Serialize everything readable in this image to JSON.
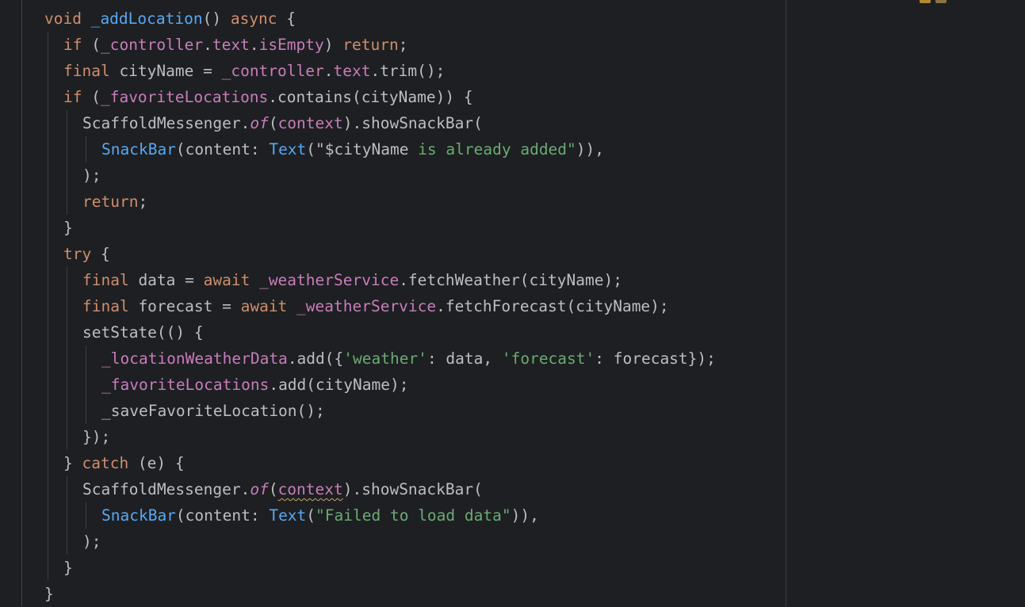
{
  "editor": {
    "language": "Dart",
    "colors": {
      "background": "#1e1f22",
      "default": "#bcbec4",
      "keyword": "#cf8e6d",
      "field": "#c77dbb",
      "method": "#56a8f5",
      "class": "#56a8f5",
      "string": "#6aab73",
      "static_method": "#c77dbb",
      "indent_guide": "#3c3e44",
      "right_margin": "#393b40",
      "warning": "#c9a26d"
    },
    "lines": [
      {
        "indent": 0,
        "tokens": [
          {
            "t": "void ",
            "c": "keyword"
          },
          {
            "t": "_addLocation",
            "c": "method"
          },
          {
            "t": "() ",
            "c": "default"
          },
          {
            "t": "async",
            "c": "keyword"
          },
          {
            "t": " {",
            "c": "default"
          }
        ]
      },
      {
        "indent": 1,
        "tokens": [
          {
            "t": "if",
            "c": "keyword"
          },
          {
            "t": " (",
            "c": "default"
          },
          {
            "t": "_controller",
            "c": "field"
          },
          {
            "t": ".",
            "c": "default"
          },
          {
            "t": "text",
            "c": "field"
          },
          {
            "t": ".",
            "c": "default"
          },
          {
            "t": "isEmpty",
            "c": "field"
          },
          {
            "t": ") ",
            "c": "default"
          },
          {
            "t": "return",
            "c": "keyword"
          },
          {
            "t": ";",
            "c": "default"
          }
        ]
      },
      {
        "indent": 1,
        "tokens": [
          {
            "t": "final",
            "c": "keyword"
          },
          {
            "t": " cityName = ",
            "c": "default"
          },
          {
            "t": "_controller",
            "c": "field"
          },
          {
            "t": ".",
            "c": "default"
          },
          {
            "t": "text",
            "c": "field"
          },
          {
            "t": ".trim();",
            "c": "default"
          }
        ]
      },
      {
        "indent": 1,
        "tokens": [
          {
            "t": "if",
            "c": "keyword"
          },
          {
            "t": " (",
            "c": "default"
          },
          {
            "t": "_favoriteLocations",
            "c": "field"
          },
          {
            "t": ".contains(cityName)) {",
            "c": "default"
          }
        ]
      },
      {
        "indent": 2,
        "tokens": [
          {
            "t": "ScaffoldMessenger.",
            "c": "default"
          },
          {
            "t": "of",
            "c": "static_method",
            "italic": true
          },
          {
            "t": "(",
            "c": "default"
          },
          {
            "t": "context",
            "c": "field"
          },
          {
            "t": ").showSnackBar(",
            "c": "default"
          }
        ]
      },
      {
        "indent": 3,
        "tokens": [
          {
            "t": "SnackBar",
            "c": "class"
          },
          {
            "t": "(content: ",
            "c": "default"
          },
          {
            "t": "Text",
            "c": "class"
          },
          {
            "t": "(\"",
            "c": "default"
          },
          {
            "t": "$cityName",
            "c": "default"
          },
          {
            "t": " is already added\"",
            "c": "string"
          },
          {
            "t": ")),",
            "c": "default"
          }
        ]
      },
      {
        "indent": 2,
        "tokens": [
          {
            "t": ");",
            "c": "default"
          }
        ]
      },
      {
        "indent": 2,
        "tokens": [
          {
            "t": "return",
            "c": "keyword"
          },
          {
            "t": ";",
            "c": "default"
          }
        ]
      },
      {
        "indent": 1,
        "tokens": [
          {
            "t": "}",
            "c": "default"
          }
        ]
      },
      {
        "indent": 1,
        "tokens": [
          {
            "t": "try",
            "c": "keyword"
          },
          {
            "t": " {",
            "c": "default"
          }
        ]
      },
      {
        "indent": 2,
        "tokens": [
          {
            "t": "final",
            "c": "keyword"
          },
          {
            "t": " data = ",
            "c": "default"
          },
          {
            "t": "await",
            "c": "keyword"
          },
          {
            "t": " ",
            "c": "default"
          },
          {
            "t": "_weatherService",
            "c": "field"
          },
          {
            "t": ".fetchWeather(cityName);",
            "c": "default"
          }
        ]
      },
      {
        "indent": 2,
        "tokens": [
          {
            "t": "final",
            "c": "keyword"
          },
          {
            "t": " forecast = ",
            "c": "default"
          },
          {
            "t": "await",
            "c": "keyword"
          },
          {
            "t": " ",
            "c": "default"
          },
          {
            "t": "_weatherService",
            "c": "field"
          },
          {
            "t": ".fetchForecast(cityName);",
            "c": "default"
          }
        ]
      },
      {
        "indent": 2,
        "tokens": [
          {
            "t": "setState(() {",
            "c": "default"
          }
        ]
      },
      {
        "indent": 3,
        "tokens": [
          {
            "t": "_locationWeatherData",
            "c": "field"
          },
          {
            "t": ".add({",
            "c": "default"
          },
          {
            "t": "'weather'",
            "c": "string"
          },
          {
            "t": ": data, ",
            "c": "default"
          },
          {
            "t": "'forecast'",
            "c": "string"
          },
          {
            "t": ": forecast});",
            "c": "default"
          }
        ]
      },
      {
        "indent": 3,
        "tokens": [
          {
            "t": "_favoriteLocations",
            "c": "field"
          },
          {
            "t": ".add(cityName);",
            "c": "default"
          }
        ]
      },
      {
        "indent": 3,
        "tokens": [
          {
            "t": "_saveFavoriteLocation();",
            "c": "default"
          }
        ]
      },
      {
        "indent": 2,
        "tokens": [
          {
            "t": "});",
            "c": "default"
          }
        ]
      },
      {
        "indent": 1,
        "tokens": [
          {
            "t": "} ",
            "c": "default"
          },
          {
            "t": "catch",
            "c": "keyword"
          },
          {
            "t": " (e) {",
            "c": "default"
          }
        ]
      },
      {
        "indent": 2,
        "tokens": [
          {
            "t": "ScaffoldMessenger.",
            "c": "default"
          },
          {
            "t": "of",
            "c": "static_method",
            "italic": true
          },
          {
            "t": "(",
            "c": "default"
          },
          {
            "t": "context",
            "c": "field",
            "warning": true
          },
          {
            "t": ").showSnackBar(",
            "c": "default"
          }
        ]
      },
      {
        "indent": 3,
        "tokens": [
          {
            "t": "SnackBar",
            "c": "class"
          },
          {
            "t": "(content: ",
            "c": "default"
          },
          {
            "t": "Text",
            "c": "class"
          },
          {
            "t": "(",
            "c": "default"
          },
          {
            "t": "\"Failed to load data\"",
            "c": "string"
          },
          {
            "t": ")),",
            "c": "default"
          }
        ]
      },
      {
        "indent": 2,
        "tokens": [
          {
            "t": ");",
            "c": "default"
          }
        ]
      },
      {
        "indent": 1,
        "tokens": [
          {
            "t": "}",
            "c": "default"
          }
        ]
      },
      {
        "indent": 0,
        "tokens": [
          {
            "t": "}",
            "c": "default"
          }
        ]
      }
    ],
    "inspection_icons": [
      "warning-icon",
      "weak-warning-icon"
    ]
  }
}
